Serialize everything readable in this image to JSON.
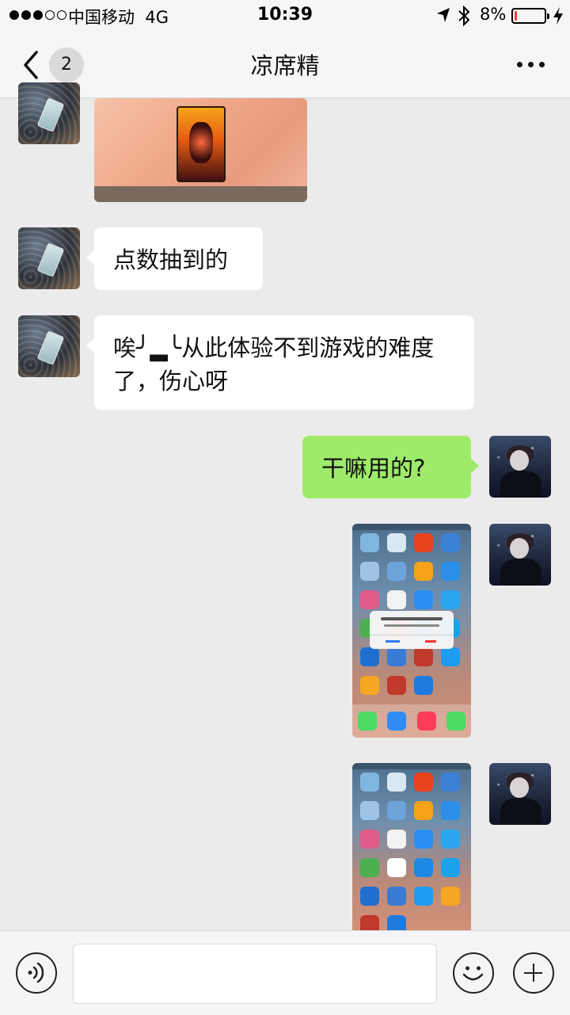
{
  "status_bar": {
    "carrier": "中国移动",
    "network": "4G",
    "time": "10:39",
    "battery_percent": "8%",
    "battery_level": 0.08,
    "icons": [
      "signal-dots-icon",
      "location-arrow-icon",
      "bluetooth-icon",
      "battery-icon",
      "charging-bolt-icon"
    ]
  },
  "nav_bar": {
    "back_icon": "chevron-left-icon",
    "unread_count": "2",
    "title": "凉席精",
    "more_icon": "ellipsis-icon"
  },
  "messages": [
    {
      "sender": "them",
      "type": "image",
      "description_icon": "game-card-image"
    },
    {
      "sender": "them",
      "type": "text",
      "text": "点数抽到的"
    },
    {
      "sender": "them",
      "type": "text",
      "text": "唉╯▂╰从此体验不到游戏的难度了，伤心呀"
    },
    {
      "sender": "me",
      "type": "text",
      "text": "干嘛用的?"
    },
    {
      "sender": "me",
      "type": "image",
      "description_icon": "phone-screenshot-image"
    },
    {
      "sender": "me",
      "type": "image",
      "description_icon": "phone-screenshot-image"
    }
  ],
  "input_bar": {
    "voice_icon": "voice-icon",
    "text_value": "",
    "emoji_icon": "emoji-icon",
    "plus_icon": "plus-icon"
  },
  "colors": {
    "outgoing_bubble": "#9eea6a",
    "incoming_bubble": "#ffffff",
    "background": "#ebebeb",
    "battery_low": "#ff3b30"
  }
}
